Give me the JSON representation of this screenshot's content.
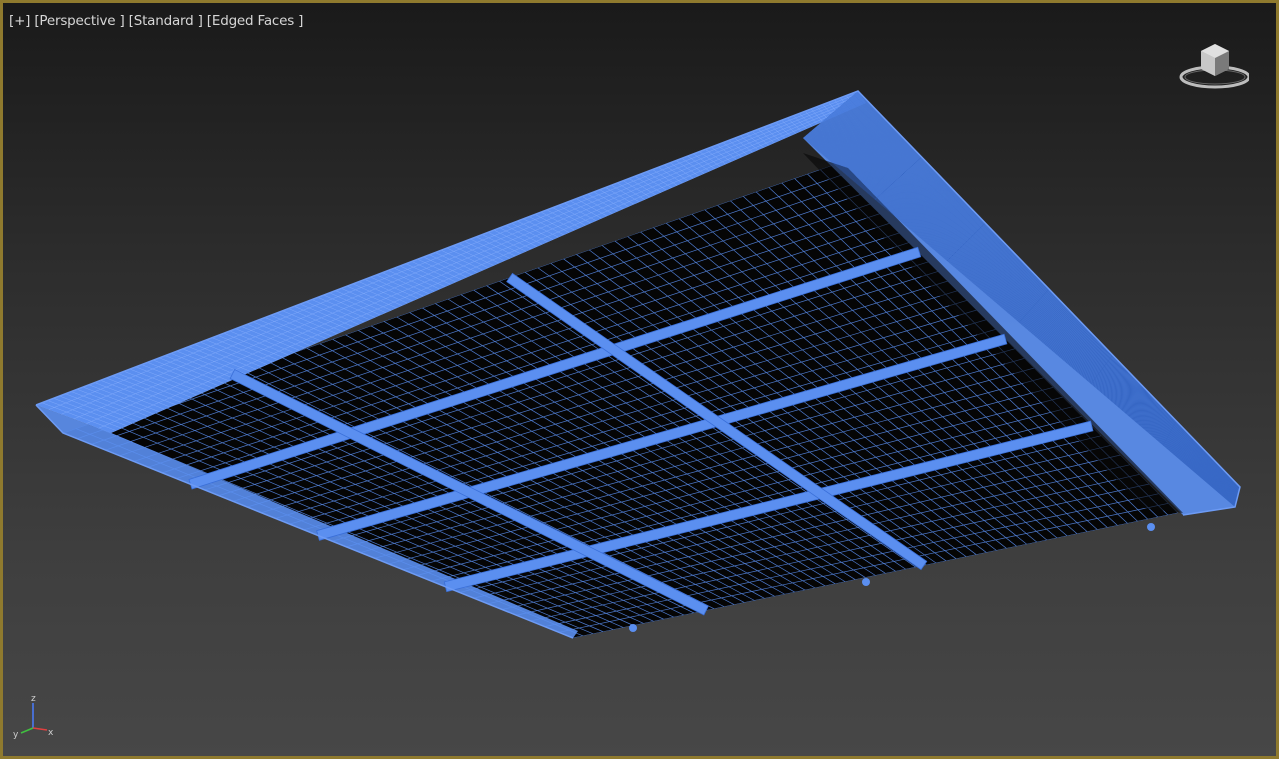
{
  "viewport": {
    "label_plus": "[+]",
    "label_view": "[Perspective ]",
    "label_shading": "[Standard ]",
    "label_mode": "[Edged Faces ]",
    "border_color": "#8f7a2e",
    "wire_color": "#5b8ff0"
  },
  "axis": {
    "z": "z",
    "y": "y",
    "x": "x"
  },
  "icons": [
    "viewcube-icon",
    "axis-tripod-icon"
  ]
}
